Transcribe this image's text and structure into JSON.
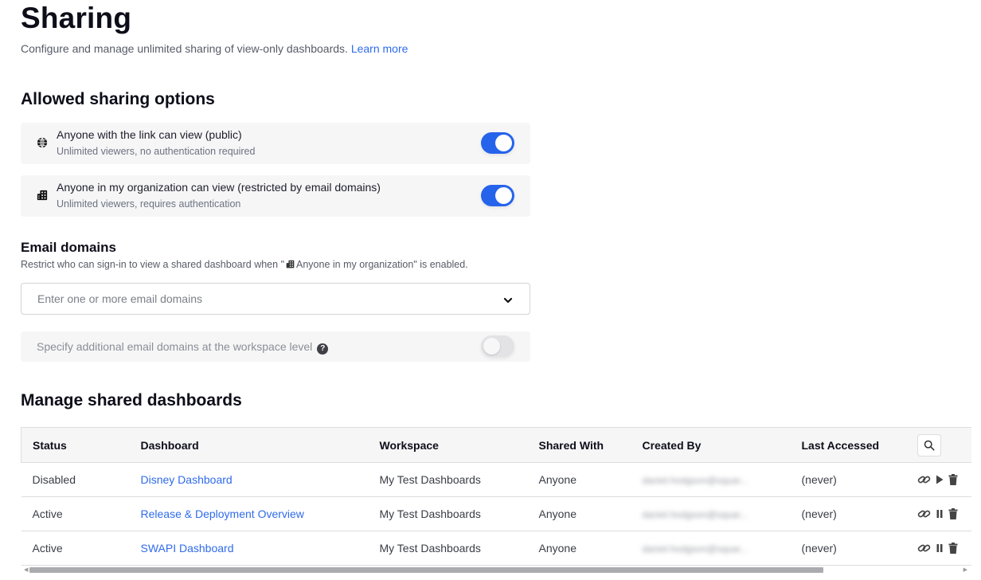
{
  "header": {
    "title": "Sharing",
    "subtitle": "Configure and manage unlimited sharing of view-only dashboards.",
    "learn_more": "Learn more"
  },
  "allowed_options": {
    "title": "Allowed sharing options",
    "options": [
      {
        "icon": "globe-icon",
        "label": "Anyone with the link can view (public)",
        "description": "Unlimited viewers, no authentication required",
        "enabled": true
      },
      {
        "icon": "building-icon",
        "label": "Anyone in my organization can view (restricted by email domains)",
        "description": "Unlimited viewers, requires authentication",
        "enabled": true
      }
    ]
  },
  "email_domains": {
    "title": "Email domains",
    "help_prefix": "Restrict who can sign-in to view a shared dashboard when \"",
    "help_suffix": "Anyone in my organization\" is enabled.",
    "placeholder": "Enter one or more email domains",
    "workspace_label": "Specify additional email domains at the workspace level",
    "workspace_help": "?",
    "workspace_enabled": false
  },
  "manage": {
    "title": "Manage shared dashboards",
    "columns": [
      "Status",
      "Dashboard",
      "Workspace",
      "Shared With",
      "Created By",
      "Last Accessed"
    ],
    "rows": [
      {
        "status": "Disabled",
        "dashboard": "Disney Dashboard",
        "workspace": "My Test Dashboards",
        "shared_with": "Anyone",
        "created_by": "daniel.hodgson@squar...",
        "last_accessed": "(never)",
        "toggle_action": "play"
      },
      {
        "status": "Active",
        "dashboard": "Release & Deployment Overview",
        "workspace": "My Test Dashboards",
        "shared_with": "Anyone",
        "created_by": "daniel.hodgson@squar...",
        "last_accessed": "(never)",
        "toggle_action": "pause"
      },
      {
        "status": "Active",
        "dashboard": "SWAPI Dashboard",
        "workspace": "My Test Dashboards",
        "shared_with": "Anyone",
        "created_by": "daniel.hodgson@squar...",
        "last_accessed": "(never)",
        "toggle_action": "pause"
      }
    ]
  },
  "colors": {
    "accent": "#2563eb",
    "link": "#2f6bea",
    "card_bg": "#f6f6f7"
  }
}
